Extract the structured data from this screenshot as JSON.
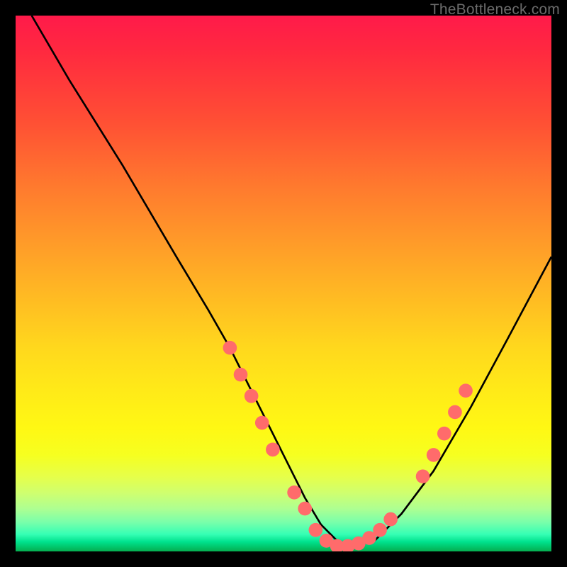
{
  "watermark": "TheBottleneck.com",
  "chart_data": {
    "type": "line",
    "title": "",
    "xlabel": "",
    "ylabel": "",
    "x_range": [
      0,
      100
    ],
    "y_range": [
      0,
      100
    ],
    "grid": false,
    "legend": false,
    "series": [
      {
        "name": "curve",
        "color": "#000000",
        "x": [
          3,
          10,
          20,
          30,
          36,
          40,
          45,
          50,
          54,
          57,
          60,
          63,
          67,
          72,
          78,
          85,
          92,
          100
        ],
        "y": [
          100,
          88,
          72,
          55,
          45,
          38,
          28,
          18,
          10,
          5,
          2,
          1,
          2,
          7,
          15,
          27,
          40,
          55
        ]
      }
    ],
    "markers": [
      {
        "x": 40,
        "y": 38
      },
      {
        "x": 42,
        "y": 33
      },
      {
        "x": 44,
        "y": 29
      },
      {
        "x": 46,
        "y": 24
      },
      {
        "x": 48,
        "y": 19
      },
      {
        "x": 52,
        "y": 11
      },
      {
        "x": 54,
        "y": 8
      },
      {
        "x": 56,
        "y": 4
      },
      {
        "x": 58,
        "y": 2
      },
      {
        "x": 60,
        "y": 1
      },
      {
        "x": 62,
        "y": 1
      },
      {
        "x": 64,
        "y": 1.5
      },
      {
        "x": 66,
        "y": 2.5
      },
      {
        "x": 68,
        "y": 4
      },
      {
        "x": 70,
        "y": 6
      },
      {
        "x": 76,
        "y": 14
      },
      {
        "x": 78,
        "y": 18
      },
      {
        "x": 80,
        "y": 22
      },
      {
        "x": 82,
        "y": 26
      },
      {
        "x": 84,
        "y": 30
      }
    ],
    "marker_color": "#ff6b6b",
    "background_gradient": {
      "top": "#ff1a4a",
      "mid": "#ffea18",
      "bottom": "#05ad50"
    }
  }
}
